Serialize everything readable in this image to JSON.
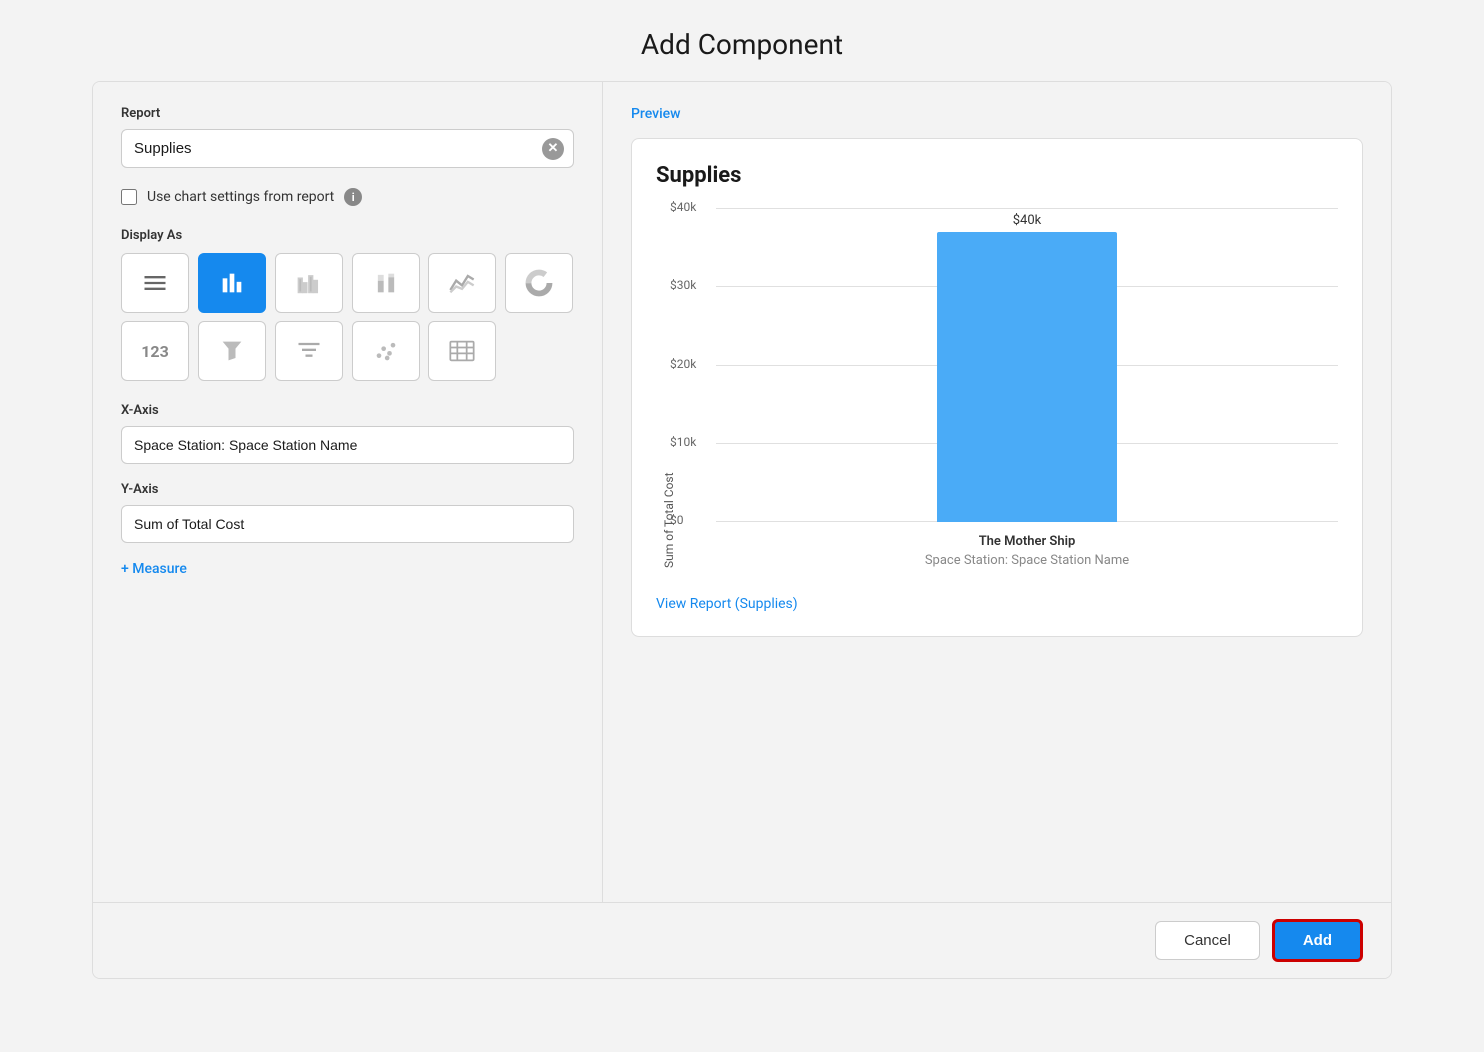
{
  "page": {
    "title": "Add Component"
  },
  "left": {
    "report_label": "Report",
    "report_value": "Supplies",
    "report_placeholder": "Report",
    "use_chart_settings_label": "Use chart settings from report",
    "display_as_label": "Display As",
    "display_options": [
      {
        "id": "table",
        "icon": "table-icon",
        "active": false
      },
      {
        "id": "bar-chart",
        "icon": "bar-chart-icon",
        "active": true
      },
      {
        "id": "grouped-bar",
        "icon": "grouped-bar-icon",
        "active": false
      },
      {
        "id": "stacked-bar",
        "icon": "stacked-bar-icon",
        "active": false
      },
      {
        "id": "line-chart",
        "icon": "line-chart-icon",
        "active": false
      },
      {
        "id": "donut-chart",
        "icon": "donut-chart-icon",
        "active": false
      },
      {
        "id": "number",
        "icon": "number-icon",
        "active": false
      },
      {
        "id": "funnel",
        "icon": "funnel-icon",
        "active": false
      },
      {
        "id": "filter-list",
        "icon": "filter-list-icon",
        "active": false
      },
      {
        "id": "scatter",
        "icon": "scatter-icon",
        "active": false
      },
      {
        "id": "data-table",
        "icon": "data-table-icon",
        "active": false
      }
    ],
    "x_axis_label": "X-Axis",
    "x_axis_value": "Space Station: Space Station Name",
    "y_axis_label": "Y-Axis",
    "y_axis_value": "Sum of Total Cost",
    "measure_label": "+ Measure"
  },
  "right": {
    "preview_label": "Preview",
    "chart_title": "Supplies",
    "y_axis_name": "Sum of Total Cost",
    "bar_value_label": "$40k",
    "y_ticks": [
      "$40k",
      "$30k",
      "$20k",
      "$10k",
      "$0"
    ],
    "bar_height_pct": 93,
    "x_bar_label": "The Mother Ship",
    "x_axis_name": "Space Station: Space Station Name",
    "view_report_link": "View Report (Supplies)"
  },
  "footer": {
    "cancel_label": "Cancel",
    "add_label": "Add"
  }
}
